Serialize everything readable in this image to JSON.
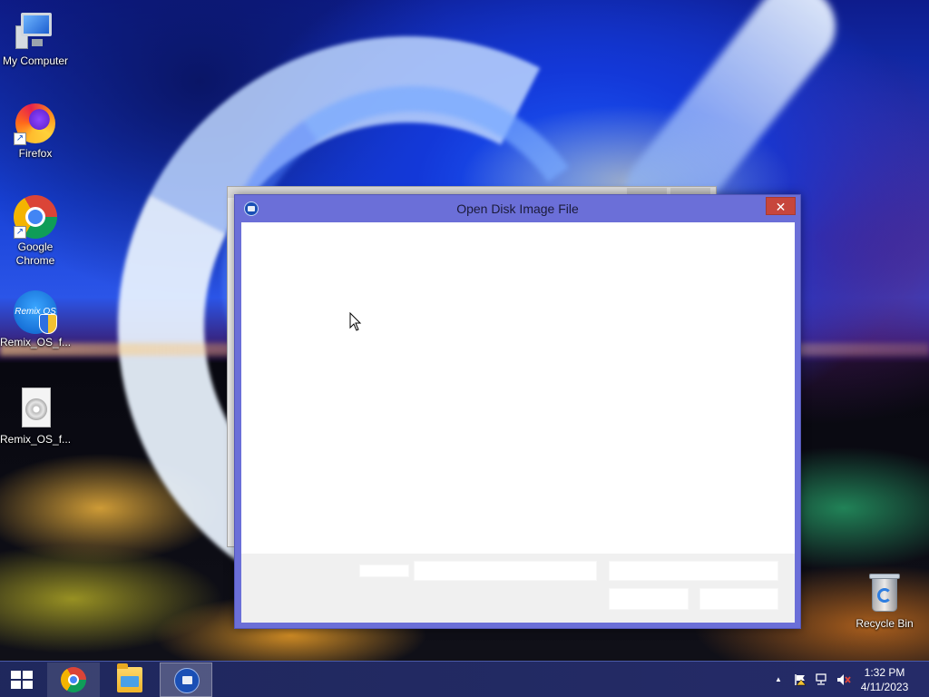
{
  "desktop": {
    "icons": [
      {
        "label": "My Computer",
        "icon": "computer-icon"
      },
      {
        "label": "Firefox",
        "icon": "firefox-icon"
      },
      {
        "label": "Google Chrome",
        "icon": "chrome-icon"
      },
      {
        "label": "Remix_OS_f...",
        "icon": "remix-os-installer-icon"
      },
      {
        "label": "Remix_OS_f...",
        "icon": "disc-image-file-icon"
      },
      {
        "label": "Recycle Bin",
        "icon": "recycle-bin-icon"
      }
    ],
    "remix_badge_text": "Remix OS"
  },
  "dialog": {
    "title": "Open Disk Image File",
    "close_glyph": "✕"
  },
  "taskbar": {
    "start_icon": "windows-logo-icon",
    "apps": [
      {
        "name": "Google Chrome",
        "icon": "chrome-icon"
      },
      {
        "name": "File Explorer",
        "icon": "folder-icon"
      },
      {
        "name": "Disk Image App",
        "icon": "disk-image-app-icon",
        "active": true
      }
    ],
    "tray": {
      "show_hidden_glyph": "▲",
      "icons": [
        "action-center-flag-icon",
        "network-icon",
        "volume-muted-icon"
      ]
    },
    "clock": {
      "time": "1:32 PM",
      "date": "4/11/2023"
    }
  },
  "colors": {
    "dialog_frame": "#6b6fd8",
    "close_button": "#c7463c",
    "taskbar": "#262c68"
  }
}
